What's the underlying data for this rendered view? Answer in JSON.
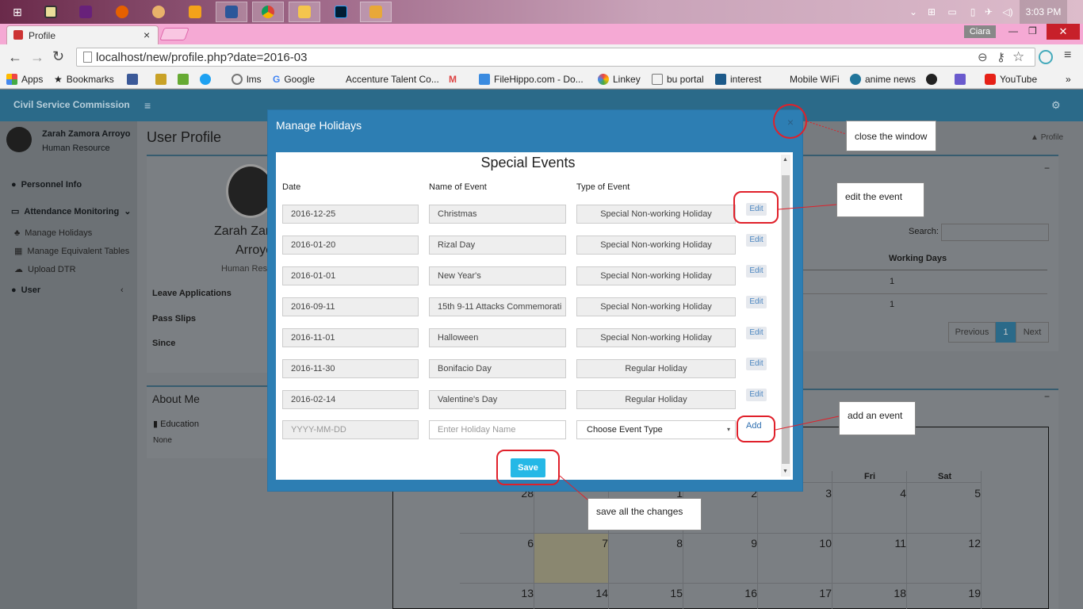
{
  "taskbar": {
    "clock": "3:03 PM",
    "icons": [
      "windows-start-icon",
      "media-icon",
      "visual-studio-icon",
      "firefox-icon",
      "paint-icon",
      "player-icon",
      "word-icon",
      "chrome-icon",
      "file-explorer-icon",
      "photoshop-icon",
      "app-icon"
    ]
  },
  "browser": {
    "tab_title": "Profile",
    "tab_close": "×",
    "user_badge": "Ciara",
    "url": "localhost/new/profile.php?date=2016-03",
    "bookmarks": [
      "Apps",
      "Bookmarks",
      "lms",
      "Google",
      "Accenture Talent Co...",
      "FileHippo.com - Do...",
      "Linkey",
      "bu portal",
      "interest",
      "Mobile WiFi",
      "anime news",
      "YouTube"
    ]
  },
  "app": {
    "brand": "Civil Service Commission",
    "user_name": "Zarah Zamora Arroyo",
    "user_role": "Human Resource",
    "sidebar": {
      "personnel": "Personnel Info",
      "attendance": "Attendance Monitoring",
      "manage_holidays": "Manage Holidays",
      "manage_tables": "Manage Equivalent Tables",
      "upload_dtr": "Upload DTR",
      "user": "User"
    },
    "page_title": "User Profile",
    "breadcrumb": "Profile",
    "profile": {
      "name_line1": "Zarah Zan",
      "name_line2": "Arroyo",
      "role": "Human Res"
    },
    "profile_rows": [
      "Leave Applications",
      "Pass Slips",
      "Since"
    ],
    "about": {
      "title": "About Me",
      "education_label": "Education",
      "education_value": "None"
    },
    "table": {
      "search_label": "Search:",
      "col_working_days": "Working Days",
      "rows": [
        "1",
        "1"
      ],
      "pager": {
        "prev": "Previous",
        "page": "1",
        "next": "Next"
      }
    },
    "calendar": {
      "days_header": [
        "Fri",
        "Sat"
      ],
      "numbers": [
        "28",
        "1",
        "2",
        "3",
        "4",
        "5",
        "6",
        "7",
        "8",
        "9",
        "10",
        "11",
        "12",
        "13",
        "14",
        "15",
        "16",
        "17",
        "18",
        "19"
      ]
    }
  },
  "modal": {
    "title": "Manage Holidays",
    "close": "×",
    "section_title": "Special Events",
    "headers": {
      "date": "Date",
      "name": "Name of Event",
      "type": "Type of Event"
    },
    "events": [
      {
        "date": "2016-12-25",
        "name": "Christmas",
        "type": "Special Non-working Holiday",
        "action": "Edit"
      },
      {
        "date": "2016-01-20",
        "name": "Rizal Day",
        "type": "Special Non-working Holiday",
        "action": "Edit"
      },
      {
        "date": "2016-01-01",
        "name": "New Year's",
        "type": "Special Non-working Holiday",
        "action": "Edit"
      },
      {
        "date": "2016-09-11",
        "name": "15th 9-11 Attacks Commemorati",
        "type": "Special Non-working Holiday",
        "action": "Edit"
      },
      {
        "date": "2016-11-01",
        "name": "Halloween",
        "type": "Special Non-working Holiday",
        "action": "Edit"
      },
      {
        "date": "2016-11-30",
        "name": "Bonifacio Day",
        "type": "Regular Holiday",
        "action": "Edit"
      },
      {
        "date": "2016-02-14",
        "name": "Valentine's Day",
        "type": "Regular Holiday",
        "action": "Edit"
      }
    ],
    "new_row": {
      "date_placeholder": "YYYY-MM-DD",
      "name_placeholder": "Enter Holiday Name",
      "type_selected": "Choose Event Type",
      "add": "Add"
    },
    "save": "Save"
  },
  "annotations": {
    "close": "close the window",
    "edit": "edit the event",
    "add": "add an event",
    "save": "save all the changes"
  },
  "colors": {
    "modal_header": "#2d7eb3",
    "save_button": "#25b8e6",
    "annotation_ring": "#e0202a",
    "nav": "#2b6a89"
  }
}
